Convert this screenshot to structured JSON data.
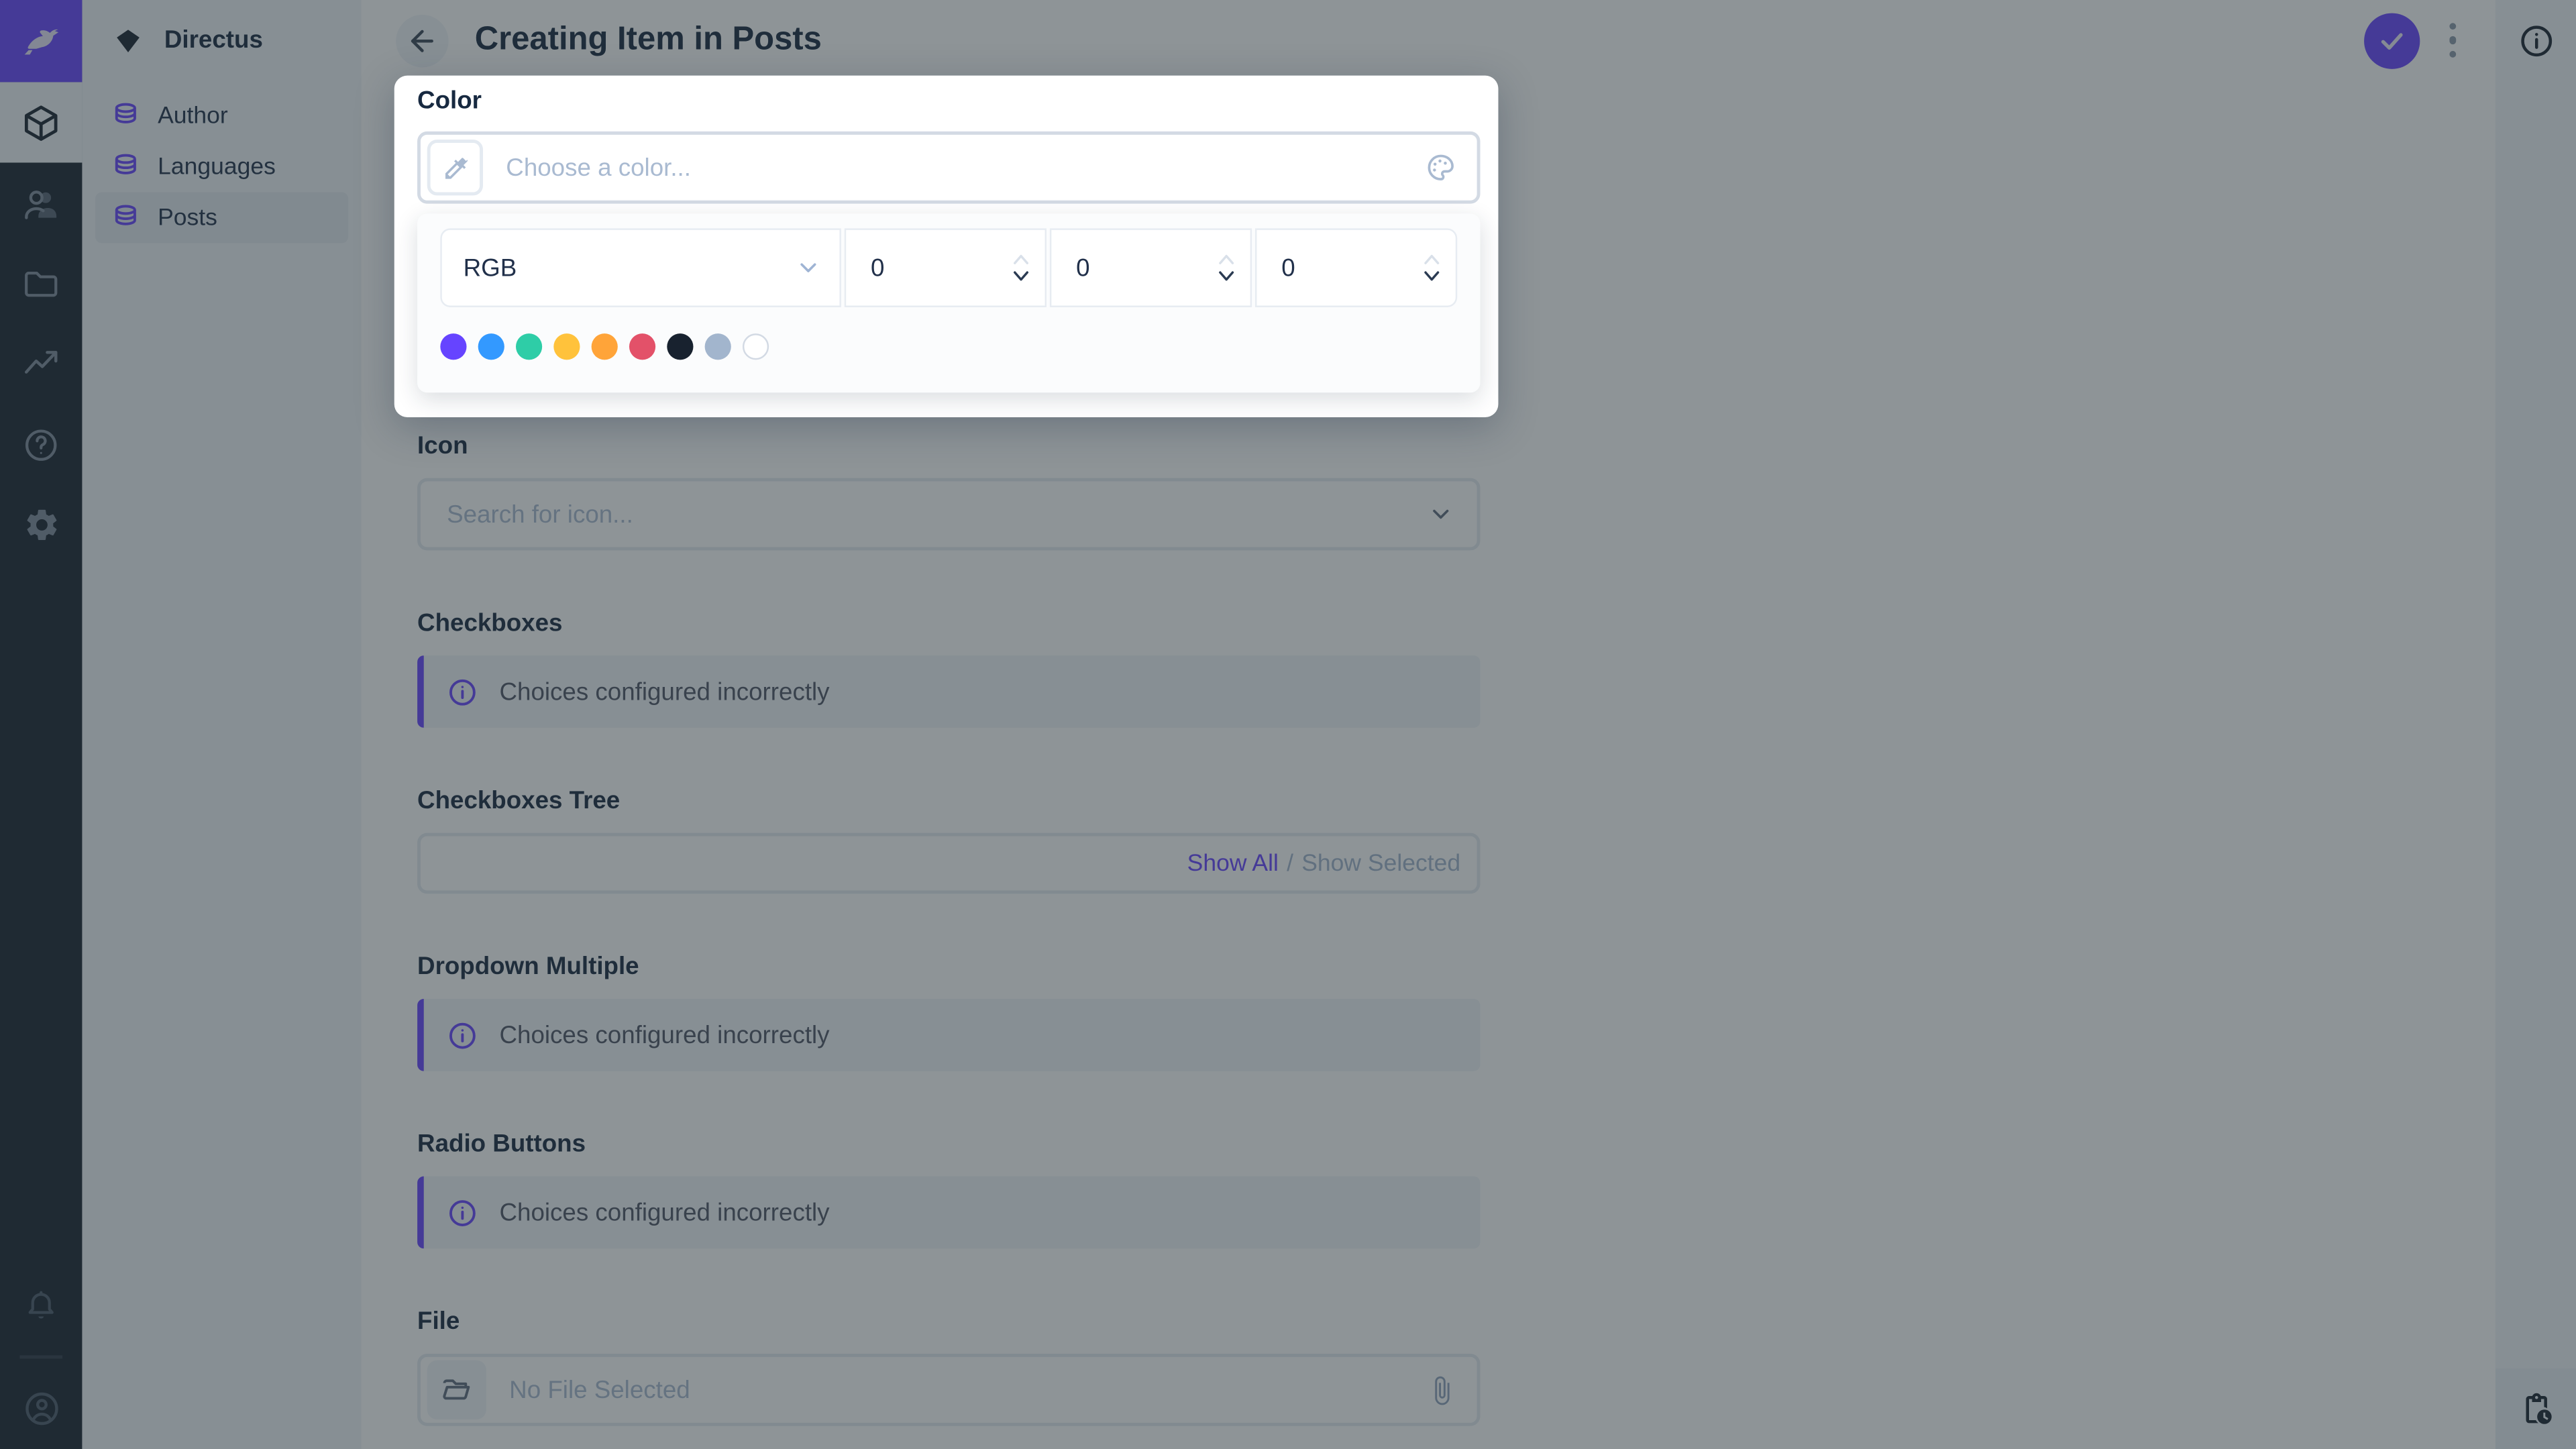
{
  "app": {
    "accent_color": "#6644FF",
    "dark_color": "#18222F",
    "subdued_color": "#A2B5CD"
  },
  "module_bar": {
    "logo_icon": "directus-rabbit-icon",
    "modules": [
      {
        "name": "content",
        "icon": "box-icon",
        "active": true
      },
      {
        "name": "users",
        "icon": "people-icon",
        "active": false
      },
      {
        "name": "files",
        "icon": "folder-icon",
        "active": false
      },
      {
        "name": "insights",
        "icon": "chart-icon",
        "active": false
      },
      {
        "name": "help",
        "icon": "help-icon",
        "active": false
      },
      {
        "name": "settings",
        "icon": "gear-icon",
        "active": false
      }
    ],
    "bottom": [
      {
        "name": "notifications",
        "icon": "bell-icon"
      },
      {
        "name": "account",
        "icon": "user-circle-icon"
      }
    ]
  },
  "nav": {
    "project_name": "Directus",
    "items": [
      {
        "label": "Author",
        "active": false
      },
      {
        "label": "Languages",
        "active": false
      },
      {
        "label": "Posts",
        "active": true
      }
    ]
  },
  "header": {
    "title": "Creating Item in Posts"
  },
  "color_popup": {
    "label": "Color",
    "placeholder": "Choose a color...",
    "mode": "RGB",
    "channels": [
      "0",
      "0",
      "0"
    ],
    "swatches": [
      "#6644FF",
      "#3399FF",
      "#2ECDA7",
      "#FFC23B",
      "#FFA439",
      "#E35169",
      "#18222F",
      "#A2B5CD",
      "#FFFFFF"
    ]
  },
  "form": {
    "fields": [
      {
        "label": "Icon",
        "placeholder": "Search for icon..."
      },
      {
        "label": "Checkboxes",
        "notice": "Choices configured incorrectly"
      },
      {
        "label": "Checkboxes Tree",
        "link_show_all": "Show All",
        "separator": "/",
        "link_show_selected": "Show Selected"
      },
      {
        "label": "Dropdown Multiple",
        "notice": "Choices configured incorrectly"
      },
      {
        "label": "Radio Buttons",
        "notice": "Choices configured incorrectly"
      },
      {
        "label": "File",
        "placeholder": "No File Selected"
      }
    ]
  }
}
